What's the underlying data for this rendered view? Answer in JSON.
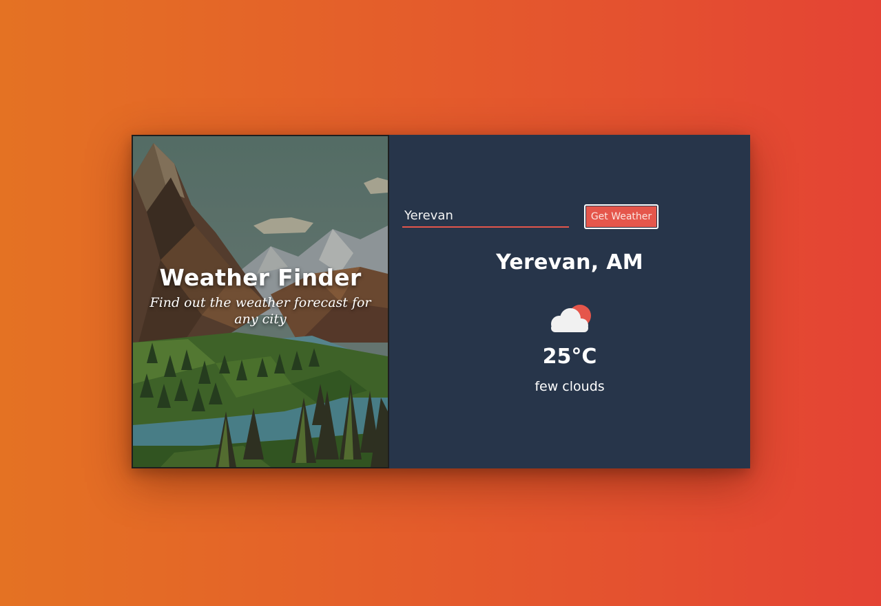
{
  "hero": {
    "title": "Weather Finder",
    "subtitle": "Find out the weather forecast for any city"
  },
  "search": {
    "value": "Yerevan",
    "button_label": "Get Weather"
  },
  "result": {
    "location": "Yerevan, AM",
    "icon": "few-clouds-icon",
    "temperature": "25°C",
    "description": "few clouds"
  },
  "colors": {
    "background_start": "#e47223",
    "background_end": "#e44334",
    "panel": "#27354a",
    "accent": "#e5564b"
  }
}
